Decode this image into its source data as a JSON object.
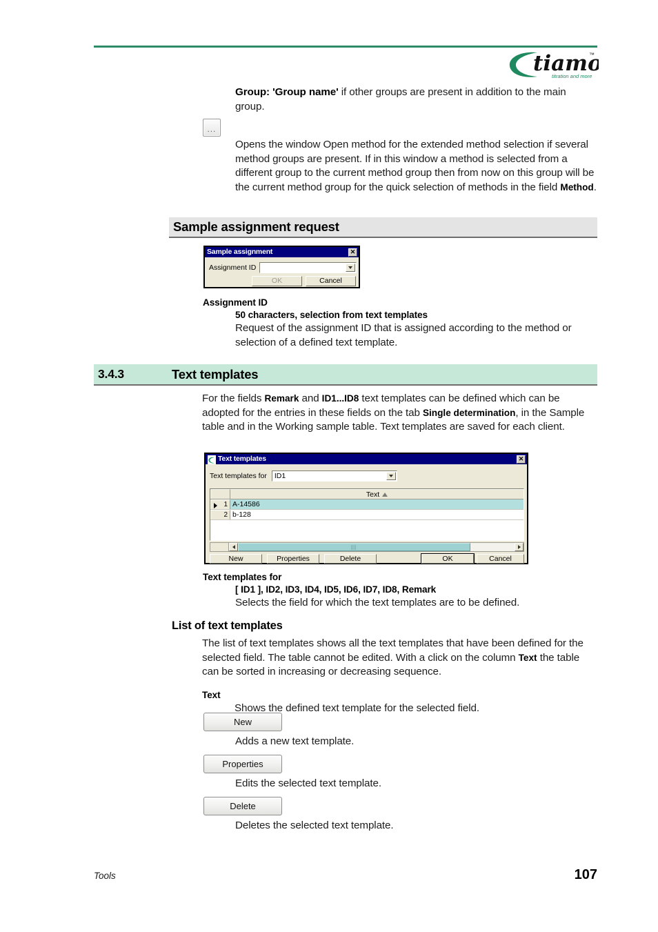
{
  "header": {
    "logo_word": "tiamo",
    "logo_tm": "™",
    "logo_tagline": "titration and more"
  },
  "intro": {
    "group_term": "Group: 'Group name'",
    "group_rest": " if other groups are present in addition to the main group.",
    "ellipsis_button": "...",
    "opens_paragraph": "Opens the window Open method for the extended method selection if several method groups are present. If in this window a method is selected from a different group to the current method group then from now on this group will be the current method group for the quick selection of methods in the field ",
    "opens_paragraph_bold_tail": "Method",
    "opens_paragraph_end": "."
  },
  "sample_section": {
    "heading": "Sample assignment request",
    "dialog": {
      "title": "Sample assignment",
      "close_label": "✕",
      "assignment_id_label": "Assignment ID",
      "assignment_id_value": "",
      "ok_label": "OK",
      "cancel_label": "Cancel"
    },
    "assignment_id_term": "Assignment ID",
    "assignment_id_subterm": "50 characters, selection from text templates",
    "assignment_id_desc": "Request of the assignment ID that is assigned according to the method or selection of a defined text template."
  },
  "section_343": {
    "number": "3.4.3",
    "title": "Text templates",
    "paragraph_1": "For the fields ",
    "paragraph_b1": "Remark",
    "paragraph_2": " and ",
    "paragraph_b2": "ID1...ID8",
    "paragraph_3": " text templates can be defined which can be adopted for the entries in these fields on the tab ",
    "paragraph_b3": "Single determination",
    "paragraph_4": ", in the Sample table and in the Working sample table. Text templates are saved for each client."
  },
  "text_templates_dialog": {
    "title": "Text templates",
    "icon": "tiamo-swoosh-icon",
    "close_label": "✕",
    "for_label": "Text templates for",
    "for_value": "ID1",
    "column_index_header": "",
    "column_text_header": "Text",
    "sort_indicator": "ascending",
    "rows": [
      {
        "index": "1",
        "text": "A-14586",
        "selected": true
      },
      {
        "index": "2",
        "text": "b-128",
        "selected": false
      }
    ],
    "buttons": {
      "new": "New",
      "properties": "Properties",
      "delete": "Delete",
      "ok": "OK",
      "cancel": "Cancel"
    }
  },
  "tt_for_block": {
    "term": "Text templates for",
    "subterm": "[ ID1 ], ID2, ID3, ID4, ID5, ID6, ID7, ID8, Remark",
    "desc": "Selects the field for which the text templates are to be defined."
  },
  "list_block": {
    "heading": "List of text templates",
    "para_1": "The list of text templates shows all the text templates that have been defined for the selected field. The table cannot be edited. With a click on the column ",
    "para_bold": "Text",
    "para_2": " the table can be sorted in increasing or decreasing sequence.",
    "text_term": "Text",
    "text_desc": "Shows the defined text template  for the selected field."
  },
  "doc_buttons": {
    "new_label": "New",
    "new_caption": "Adds a new text template.",
    "properties_label": "Properties",
    "properties_caption": "Edits the selected text template.",
    "delete_label": "Delete",
    "delete_caption": "Deletes the selected text template."
  },
  "footer": {
    "chapter": "Tools",
    "page_number": "107"
  },
  "colors": {
    "brand_green": "#2e8b68",
    "section_green": "#c6e8d8",
    "section_grey": "#e4e4e4",
    "titlebar_blue": "#00007c",
    "row_selected": "#b4dfdf"
  }
}
